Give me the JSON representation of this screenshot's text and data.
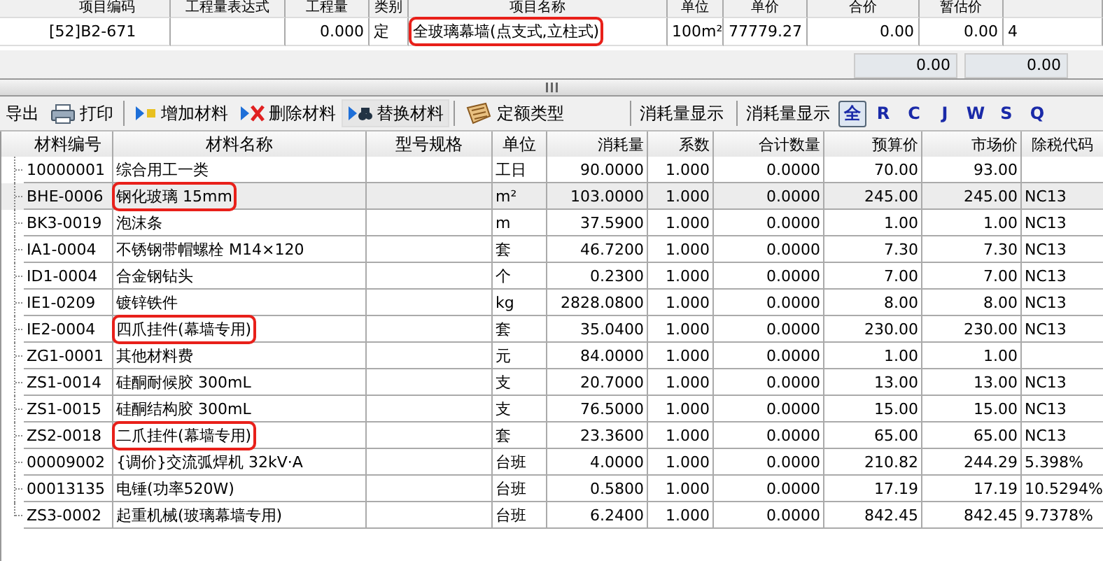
{
  "project_table": {
    "columns": [
      "项目编码",
      "工程量表达式",
      "工程量",
      "类别",
      "项目名称",
      "单位",
      "单价",
      "合价",
      "暂估价"
    ],
    "rows": [
      {
        "code": "[52]B2-671",
        "expression": "",
        "quantity": "0.000",
        "category": "定",
        "name": "全玻璃幕墙(点支式,立柱式)",
        "unit": "100m²",
        "price": "77779.27",
        "total": "0.00",
        "estimate": "0.00",
        "column_10": "4",
        "highlighted": true
      }
    ],
    "totals": [
      "0.00",
      "0.00"
    ]
  },
  "toolbar": {
    "buttons": [
      {
        "label": "导出",
        "kind": "plain"
      },
      {
        "label": "打印",
        "kind": "print"
      },
      {
        "label": "增加材料",
        "kind": "add"
      },
      {
        "label": "删除材料",
        "kind": "delete"
      },
      {
        "label": "替换材料",
        "kind": "replace"
      },
      {
        "label": "定额类型",
        "kind": "keyboard"
      }
    ],
    "labels": [
      "消耗量显示",
      "消耗量显示"
    ],
    "filters": [
      {
        "label": "全",
        "selected": true
      },
      {
        "label": "R",
        "selected": false
      },
      {
        "label": "C",
        "selected": false
      },
      {
        "label": "J",
        "selected": false
      },
      {
        "label": "W",
        "selected": false
      },
      {
        "label": "S",
        "selected": false
      },
      {
        "label": "Q",
        "selected": false
      }
    ]
  },
  "materials_table": {
    "columns": [
      "材料编号",
      "材料名称",
      "型号规格",
      "单位",
      "消耗量",
      "系数",
      "合计数量",
      "预算价",
      "市场价",
      "除税代码"
    ],
    "rows": [
      {
        "cells": [
          "10000001",
          "综合用工一类",
          "",
          "工日",
          "90.0000",
          "1.000",
          "0.0000",
          "70.00",
          "93.00",
          ""
        ],
        "selected": false,
        "highlighted": false
      },
      {
        "cells": [
          "BHE-0006",
          "钢化玻璃 15mm",
          "",
          "m²",
          "103.0000",
          "1.000",
          "0.0000",
          "245.00",
          "245.00",
          "NC13"
        ],
        "selected": true,
        "highlighted": true
      },
      {
        "cells": [
          "BK3-0019",
          "泡沫条",
          "",
          "m",
          "37.5900",
          "1.000",
          "0.0000",
          "1.00",
          "1.00",
          "NC13"
        ],
        "selected": false,
        "highlighted": false
      },
      {
        "cells": [
          "IA1-0004",
          "不锈钢带帽螺栓 M14×120",
          "",
          "套",
          "46.7200",
          "1.000",
          "0.0000",
          "7.30",
          "7.30",
          "NC13"
        ],
        "selected": false,
        "highlighted": false
      },
      {
        "cells": [
          "ID1-0004",
          "合金钢钻头",
          "",
          "个",
          "0.2300",
          "1.000",
          "0.0000",
          "7.00",
          "7.00",
          "NC13"
        ],
        "selected": false,
        "highlighted": false
      },
      {
        "cells": [
          "IE1-0209",
          "镀锌铁件",
          "",
          "kg",
          "2828.0800",
          "1.000",
          "0.0000",
          "8.00",
          "8.00",
          "NC13"
        ],
        "selected": false,
        "highlighted": false
      },
      {
        "cells": [
          "IE2-0004",
          "四爪挂件(幕墙专用)",
          "",
          "套",
          "35.0400",
          "1.000",
          "0.0000",
          "230.00",
          "230.00",
          "NC13"
        ],
        "selected": false,
        "highlighted": true
      },
      {
        "cells": [
          "ZG1-0001",
          "其他材料费",
          "",
          "元",
          "84.0000",
          "1.000",
          "0.0000",
          "1.00",
          "1.00",
          ""
        ],
        "selected": false,
        "highlighted": false
      },
      {
        "cells": [
          "ZS1-0014",
          "硅酮耐候胶 300mL",
          "",
          "支",
          "20.7000",
          "1.000",
          "0.0000",
          "13.00",
          "13.00",
          "NC13"
        ],
        "selected": false,
        "highlighted": false
      },
      {
        "cells": [
          "ZS1-0015",
          "硅酮结构胶 300mL",
          "",
          "支",
          "76.5000",
          "1.000",
          "0.0000",
          "15.00",
          "15.00",
          "NC13"
        ],
        "selected": false,
        "highlighted": false
      },
      {
        "cells": [
          "ZS2-0018",
          "二爪挂件(幕墙专用)",
          "",
          "套",
          "23.3600",
          "1.000",
          "0.0000",
          "65.00",
          "65.00",
          "NC13"
        ],
        "selected": false,
        "highlighted": true
      },
      {
        "cells": [
          "00009002",
          "{调价}交流弧焊机 32kV·A",
          "",
          "台班",
          "4.0000",
          "1.000",
          "0.0000",
          "210.82",
          "244.29",
          "5.398%"
        ],
        "selected": false,
        "highlighted": false
      },
      {
        "cells": [
          "00013135",
          "电锤(功率520W)",
          "",
          "台班",
          "0.5800",
          "1.000",
          "0.0000",
          "17.19",
          "17.19",
          "10.5294%"
        ],
        "selected": false,
        "highlighted": false
      },
      {
        "cells": [
          "ZS3-0002",
          "起重机械(玻璃幕墙专用)",
          "",
          "台班",
          "6.2400",
          "1.000",
          "0.0000",
          "842.45",
          "842.45",
          "9.7378%"
        ],
        "selected": false,
        "highlighted": false
      }
    ]
  }
}
